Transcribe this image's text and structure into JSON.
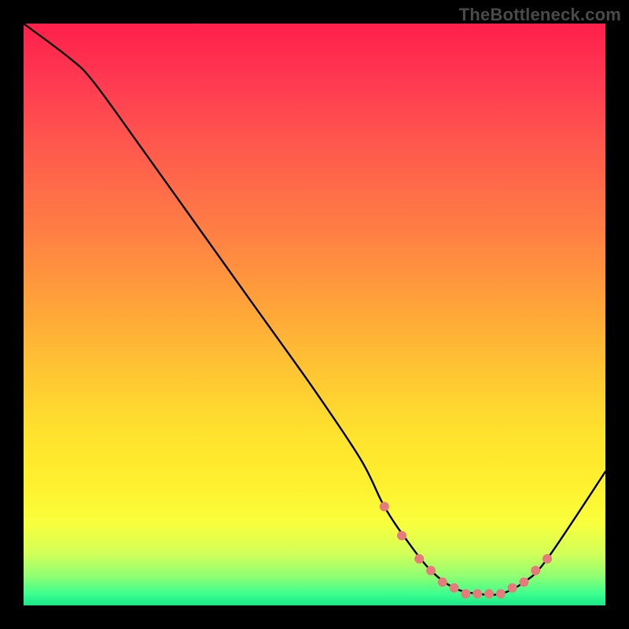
{
  "watermark": "TheBottleneck.com",
  "chart_data": {
    "type": "line",
    "title": "",
    "xlabel": "",
    "ylabel": "",
    "xlim": [
      0,
      100
    ],
    "ylim": [
      0,
      100
    ],
    "series": [
      {
        "name": "bottleneck-curve",
        "x": [
          0,
          8,
          12,
          20,
          30,
          40,
          50,
          58,
          62,
          66,
          70,
          74,
          78,
          82,
          86,
          90,
          100
        ],
        "y": [
          100,
          94,
          90,
          79,
          65,
          51,
          37,
          25,
          17,
          11,
          6,
          3,
          2,
          2,
          4,
          8,
          23
        ]
      }
    ],
    "markers": {
      "name": "highlight-dots",
      "color": "#e77a7a",
      "x": [
        62,
        65,
        68,
        70,
        72,
        74,
        76,
        78,
        80,
        82,
        84,
        86,
        88,
        90
      ],
      "y": [
        17,
        12,
        8,
        6,
        4,
        3,
        2,
        2,
        2,
        2,
        3,
        4,
        6,
        8
      ]
    },
    "gradient_stops": [
      {
        "pos": 0,
        "color": "#ff1f4b"
      },
      {
        "pos": 10,
        "color": "#ff3a52"
      },
      {
        "pos": 22,
        "color": "#ff5b4d"
      },
      {
        "pos": 35,
        "color": "#ff7d45"
      },
      {
        "pos": 48,
        "color": "#ffa23a"
      },
      {
        "pos": 60,
        "color": "#ffc633"
      },
      {
        "pos": 70,
        "color": "#ffe12e"
      },
      {
        "pos": 80,
        "color": "#fff22f"
      },
      {
        "pos": 86,
        "color": "#f8ff3d"
      },
      {
        "pos": 91,
        "color": "#d3ff58"
      },
      {
        "pos": 95,
        "color": "#8fff72"
      },
      {
        "pos": 98,
        "color": "#3dff8e"
      },
      {
        "pos": 100,
        "color": "#18e788"
      }
    ]
  }
}
